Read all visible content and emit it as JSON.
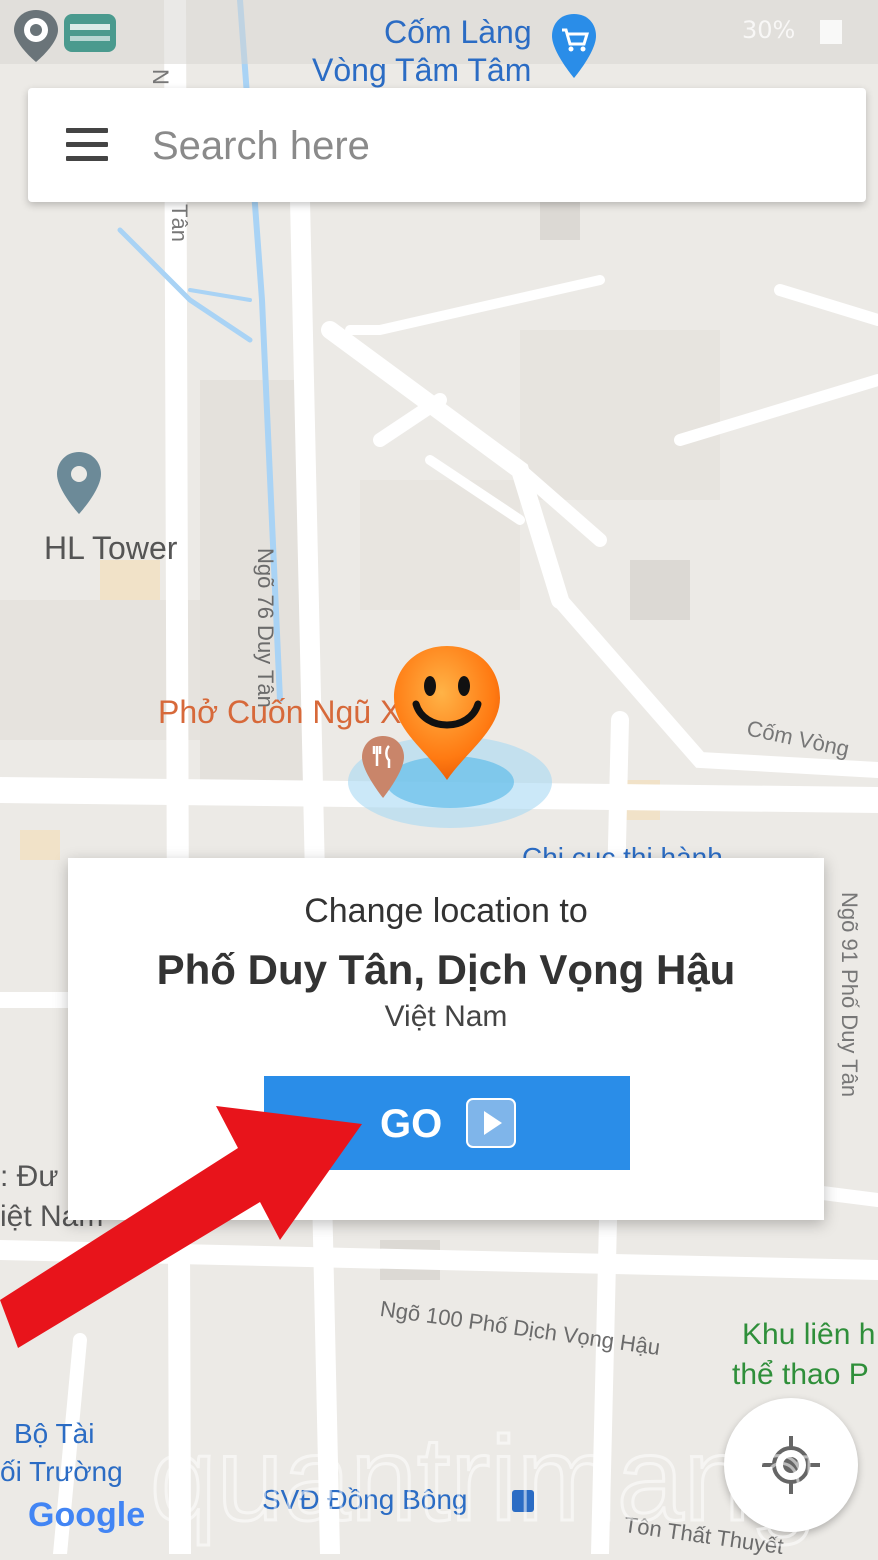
{
  "status_bar": {
    "battery_text": "30%",
    "battery_icon": "battery-icon",
    "app_icons": [
      "location-changer-app-icon",
      "carrier-app-icon"
    ]
  },
  "search": {
    "placeholder": "Search here",
    "menu_icon": "hamburger-menu-icon"
  },
  "map": {
    "poi_top": {
      "line1": "Cốm Làng",
      "line2": "Vòng Tâm Tâm",
      "icon": "shopping-cart-pin-icon"
    },
    "hl_tower": {
      "label": "HL Tower",
      "icon": "location-pin-icon"
    },
    "restaurant": {
      "label": "Phở Cuốn Ngũ X",
      "icon": "restaurant-pin-icon"
    },
    "pho_alley_lane": "Ngõ 76 Duy Tân",
    "com_vong": "Cốm Vòng",
    "chi_cuc": "Chi cục thi hành",
    "right_vertical_road": "Ngõ 91 Phố Duy Tân",
    "left_partial": {
      "line1": ": Đư",
      "line2": "iệt Nam"
    },
    "lane_100": "Ngõ 100 Phố Dịch Vọng Hậu",
    "sports_complex": {
      "line1": "Khu liên h",
      "line2": "thể thao P"
    },
    "bottom_left": {
      "line1": "Bộ Tài",
      "line2": "ối Trường"
    },
    "stadium": {
      "label": "SVĐ Đồng Bông",
      "icon": "transit-icon"
    },
    "bottom_right_road": "Tôn Thất Thuyết",
    "top_road_partial": "N",
    "top_road_partial2": "Tân",
    "google_logo": "Google",
    "marker_icon": "smiley-marker-icon"
  },
  "dialog": {
    "title": "Change location to",
    "place": "Phố Duy Tân, Dịch Vọng Hậu",
    "country": "Việt Nam",
    "go_label": "GO",
    "go_icon": "play-icon"
  },
  "overlay": {
    "arrow_icon": "red-arrow-annotation",
    "arrow_color": "#e8141b",
    "watermark": "quantrimang"
  },
  "locate_button": {
    "icon": "my-location-icon"
  },
  "colors": {
    "map_bg": "#eceae6",
    "road": "#ffffff",
    "water": "#a9d3f5",
    "accent_blue": "#2a8de8",
    "poi_orange": "#d7693a",
    "park_green": "#2f8f3a"
  }
}
